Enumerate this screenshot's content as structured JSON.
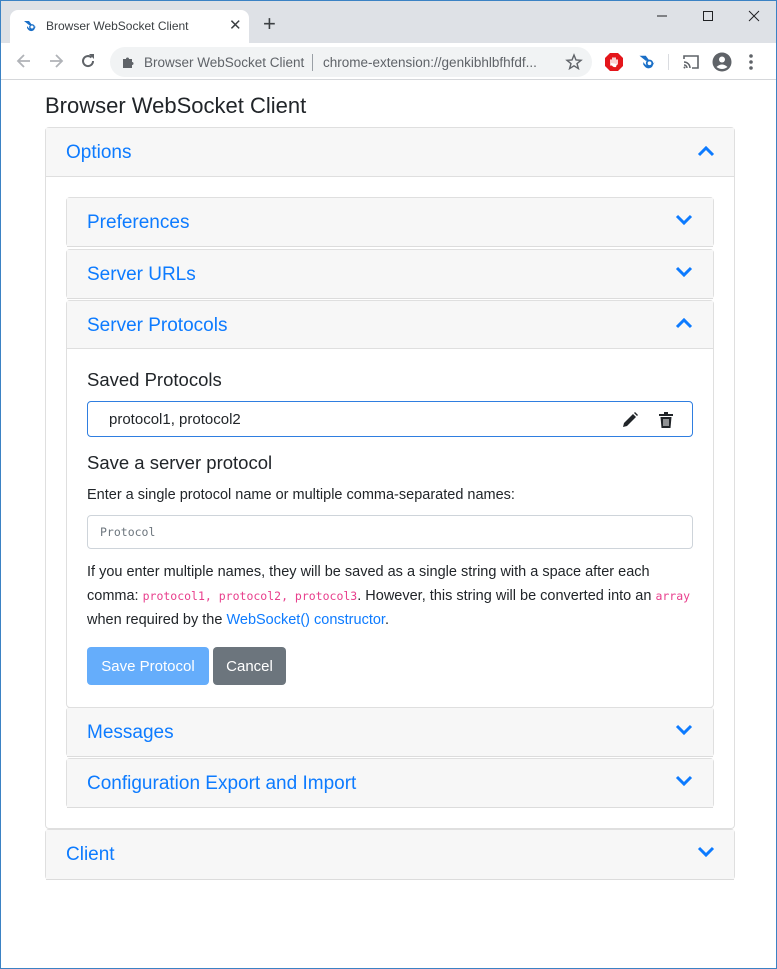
{
  "browser": {
    "tab": {
      "title": "Browser WebSocket Client",
      "close_icon": "close-icon",
      "favicon": "websocket-extension-icon"
    },
    "new_tab_label": "+",
    "window_controls": {
      "minimize": "—",
      "maximize": "□",
      "close": "✕"
    },
    "omnibox": {
      "site_name": "Browser WebSocket Client",
      "url": "chrome-extension://genkibhlbfhfdf..."
    },
    "toolbar_icons": [
      "back-icon",
      "forward-icon",
      "reload-icon",
      "extension-puzzle-icon",
      "bookmark-star-icon",
      "adblock-icon",
      "websocket-extension-icon",
      "cast-icon",
      "profile-icon",
      "menu-dots-icon"
    ]
  },
  "page": {
    "title": "Browser WebSocket Client",
    "options": {
      "label": "Options",
      "expanded": true,
      "sections": {
        "preferences": {
          "label": "Preferences",
          "expanded": false
        },
        "server_urls": {
          "label": "Server URLs",
          "expanded": false
        },
        "server_protocols": {
          "label": "Server Protocols",
          "expanded": true,
          "saved_heading": "Saved Protocols",
          "saved_items": [
            {
              "value": "protocol1, protocol2"
            }
          ],
          "save_heading": "Save a server protocol",
          "instructions": "Enter a single protocol name or multiple comma-separated names:",
          "input_placeholder": "Protocol",
          "input_value": "",
          "explanation": {
            "part1": "If you enter multiple names, they will be saved as a single string with a space after each comma: ",
            "code1": "protocol1, protocol2, protocol3",
            "part2": ". However, this string will be converted into an ",
            "code2": "array",
            "part3": " when required by the ",
            "link": "WebSocket() constructor",
            "part4": "."
          },
          "save_button": "Save Protocol",
          "cancel_button": "Cancel"
        },
        "messages": {
          "label": "Messages",
          "expanded": false
        },
        "config": {
          "label": "Configuration Export and Import",
          "expanded": false
        }
      }
    },
    "client": {
      "label": "Client",
      "expanded": false
    }
  },
  "colors": {
    "accent": "#0d7bff",
    "save_button": "#65adfb",
    "cancel_button": "#6c757d",
    "code": "#e83e8c",
    "card_header": "#f7f7f7"
  }
}
